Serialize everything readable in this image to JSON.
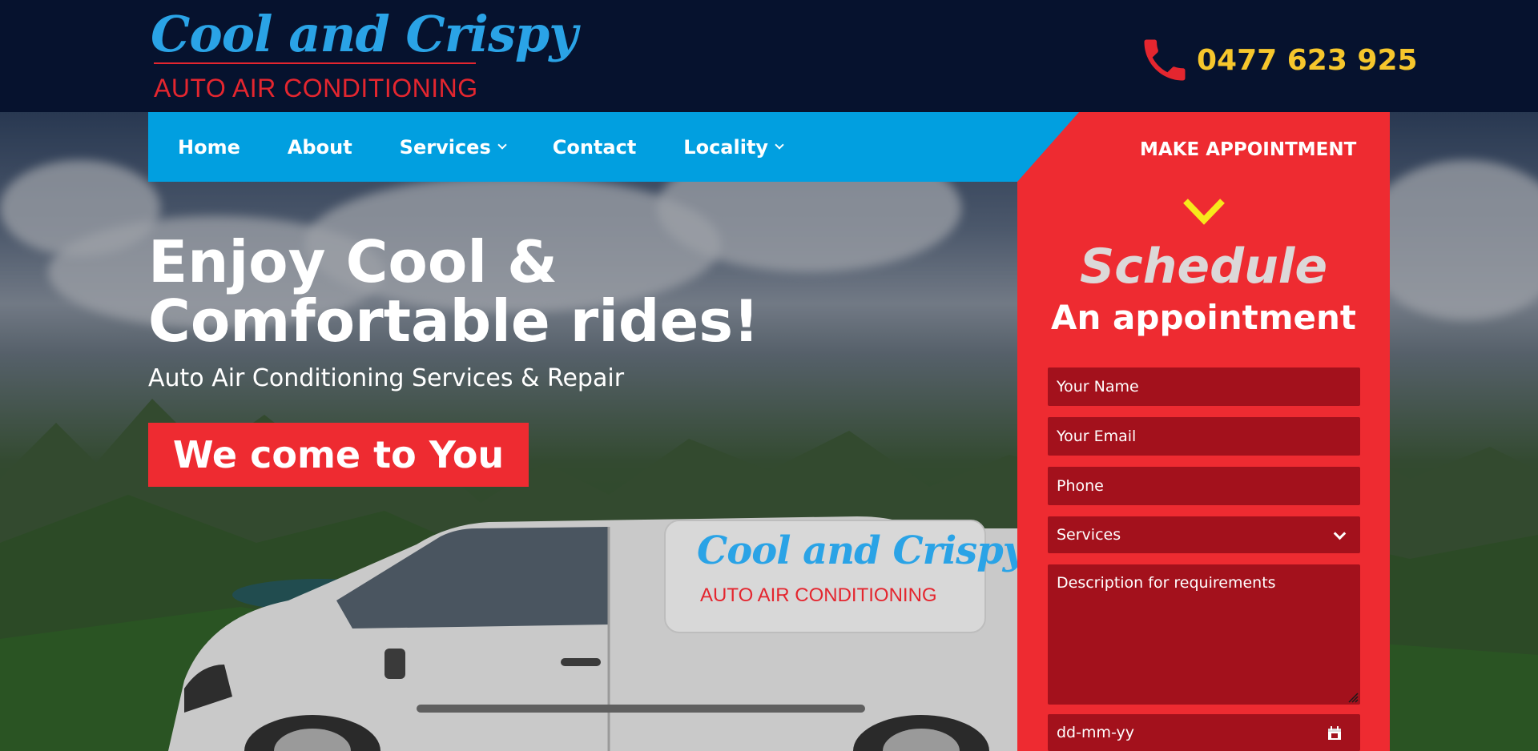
{
  "header": {
    "logo_script": "Cool and Crispy",
    "logo_sub": "AUTO AIR CONDITIONING",
    "phone_number": "0477 623 925"
  },
  "nav": {
    "items": [
      {
        "label": "Home"
      },
      {
        "label": "About"
      },
      {
        "label": "Services"
      },
      {
        "label": "Contact"
      },
      {
        "label": "Locality"
      }
    ]
  },
  "hero": {
    "title_line1": "Enjoy Cool &",
    "title_line2": "Comfortable rides!",
    "subtitle": "Auto Air Conditioning Services & Repair",
    "cta_label": "We come to You",
    "van_logo_script": "Cool and Crispy",
    "van_logo_sub": "AUTO AIR CONDITIONING"
  },
  "appointment": {
    "top_label": "MAKE APPOINTMENT",
    "heading": "Schedule",
    "subheading": "An appointment",
    "name_placeholder": "Your Name",
    "email_placeholder": "Your Email",
    "phone_placeholder": "Phone",
    "services_value": "Services",
    "description_placeholder": "Description for requirements",
    "date_placeholder": "dd-mm-yy"
  },
  "colors": {
    "header_bg": "#06122e",
    "nav_blue": "#019fe0",
    "brand_red": "#ee2b31",
    "field_red": "#a3111c",
    "phone_yellow": "#f6c62c",
    "logo_blue": "#2aa3e6"
  }
}
